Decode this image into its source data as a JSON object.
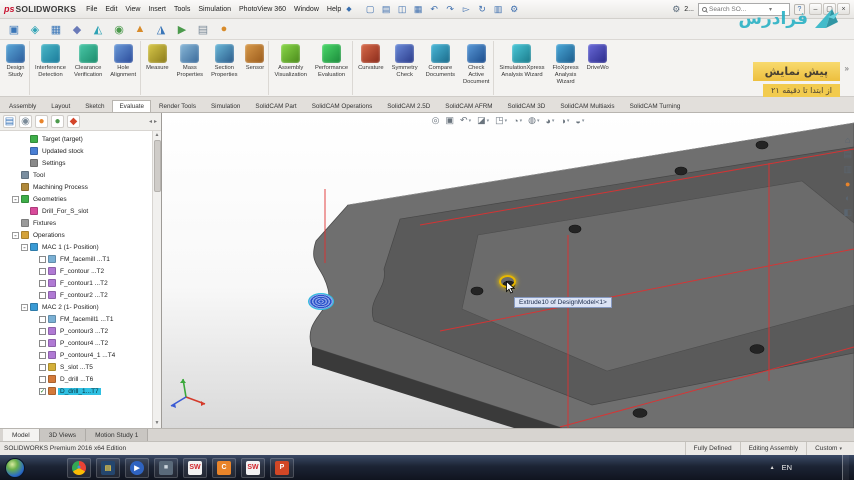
{
  "titlebar": {
    "logo_prefix": "ps",
    "logo_text": "SOLIDWORKS",
    "menus": [
      "File",
      "Edit",
      "View",
      "Insert",
      "Tools",
      "Simulation",
      "PhotoView 360",
      "Window",
      "Help"
    ],
    "pin_glyph": "◆",
    "tools": [
      {
        "name": "new-document-icon",
        "glyph": "▢"
      },
      {
        "name": "open-document-icon",
        "glyph": "▤"
      },
      {
        "name": "save-icon",
        "glyph": "◫"
      },
      {
        "name": "print-icon",
        "glyph": "▦"
      },
      {
        "name": "undo-icon",
        "glyph": "↶"
      },
      {
        "name": "redo-icon",
        "glyph": "↷"
      },
      {
        "name": "select-icon",
        "glyph": "▻"
      },
      {
        "name": "rebuild-icon",
        "glyph": "↻"
      },
      {
        "name": "file-properties-icon",
        "glyph": "▥"
      },
      {
        "name": "options-icon",
        "glyph": "⚙"
      }
    ],
    "right_text": "2...",
    "search": {
      "placeholder": "Search SO...",
      "chevron": "▾",
      "help": "?"
    },
    "window_controls": [
      {
        "name": "minimize-button",
        "glyph": "–"
      },
      {
        "name": "restore-button",
        "glyph": "▢"
      },
      {
        "name": "close-button",
        "glyph": "×"
      }
    ]
  },
  "toolbar2": {
    "icons": [
      {
        "name": "insert-components-icon",
        "glyph": "▣",
        "color": "#3a76b8"
      },
      {
        "name": "mate-icon",
        "glyph": "◈",
        "color": "#2fa3b5"
      },
      {
        "name": "linear-component-pattern-icon",
        "glyph": "▦",
        "color": "#3a76b8"
      },
      {
        "name": "smart-fasteners-icon",
        "glyph": "◆",
        "color": "#6a7ab8"
      },
      {
        "name": "move-component-icon",
        "glyph": "◭",
        "color": "#2fa3b5"
      },
      {
        "name": "show-hidden-components-icon",
        "glyph": "◉",
        "color": "#4c9a4c"
      },
      {
        "name": "assembly-features-icon",
        "glyph": "▲",
        "color": "#d88b2a"
      },
      {
        "name": "reference-geometry-icon",
        "glyph": "◮",
        "color": "#3a76b8"
      },
      {
        "name": "new-motion-study-icon",
        "glyph": "▶",
        "color": "#4c9a4c"
      },
      {
        "name": "bill-of-materials-icon",
        "glyph": "▤",
        "color": "#7a8a98"
      },
      {
        "name": "exploded-view-icon",
        "glyph": "●",
        "color": "#d88b2a"
      }
    ]
  },
  "ribbon": {
    "overflow_chevron": "»",
    "buttons": [
      {
        "name": "design-study-button",
        "lines": [
          "Design",
          "Study",
          ""
        ],
        "icon_bg": "linear-gradient(135deg,#5aa8d8,#2a5a9a)",
        "sep": "with-sep"
      },
      {
        "name": "interference-detection-button",
        "lines": [
          "Interference",
          "Detection",
          ""
        ],
        "icon_bg": "linear-gradient(135deg,#4ab8c8,#1a7a9a)",
        "sep": ""
      },
      {
        "name": "clearance-verification-button",
        "lines": [
          "Clearance",
          "Verification",
          ""
        ],
        "icon_bg": "linear-gradient(135deg,#4ac8a8,#1a8a6a)",
        "sep": ""
      },
      {
        "name": "hole-alignment-button",
        "lines": [
          "Hole",
          "Alignment",
          ""
        ],
        "icon_bg": "linear-gradient(135deg,#6a9ad8,#2a4a9a)",
        "sep": "with-sep"
      },
      {
        "name": "measure-button",
        "lines": [
          "Measure",
          "",
          ""
        ],
        "icon_bg": "linear-gradient(135deg,#d8c84a,#8a7a1a)",
        "sep": ""
      },
      {
        "name": "mass-properties-button",
        "lines": [
          "Mass",
          "Properties",
          ""
        ],
        "icon_bg": "linear-gradient(135deg,#8ab8d8,#3a6a9a)",
        "sep": ""
      },
      {
        "name": "section-properties-button",
        "lines": [
          "Section",
          "Properties",
          ""
        ],
        "icon_bg": "linear-gradient(135deg,#6ab8d8,#2a5a8a)",
        "sep": ""
      },
      {
        "name": "sensor-button",
        "lines": [
          "Sensor",
          "",
          ""
        ],
        "icon_bg": "linear-gradient(135deg,#d89a4a,#9a5a1a)",
        "sep": "with-sep"
      },
      {
        "name": "assembly-visualization-button",
        "lines": [
          "Assembly",
          "Visualization",
          ""
        ],
        "icon_bg": "linear-gradient(135deg,#8ad84a,#4a8a1a)",
        "sep": ""
      },
      {
        "name": "performance-evaluation-button",
        "lines": [
          "Performance",
          "Evaluation",
          ""
        ],
        "icon_bg": "linear-gradient(135deg,#4ad86a,#1a8a3a)",
        "sep": "with-sep"
      },
      {
        "name": "curvature-button",
        "lines": [
          "Curvature",
          "",
          ""
        ],
        "icon_bg": "linear-gradient(135deg,#d86a4a,#8a2a1a)",
        "sep": ""
      },
      {
        "name": "symmetry-check-button",
        "lines": [
          "Symmetry",
          "Check",
          ""
        ],
        "icon_bg": "linear-gradient(135deg,#6a8ad8,#2a3a8a)",
        "sep": ""
      },
      {
        "name": "compare-documents-button",
        "lines": [
          "Compare",
          "Documents",
          ""
        ],
        "icon_bg": "linear-gradient(135deg,#4ab8d8,#1a6a8a)",
        "sep": ""
      },
      {
        "name": "check-active-document-button",
        "lines": [
          "Check",
          "Active",
          "Document"
        ],
        "icon_bg": "linear-gradient(135deg,#5a9ad8,#1a4a8a)",
        "sep": "with-sep"
      },
      {
        "name": "simulationxpress-analysis-wizard-button",
        "lines": [
          "SimulationXpress",
          "Analysis Wizard",
          ""
        ],
        "icon_bg": "linear-gradient(135deg,#4ac8d8,#1a7a8a)",
        "sep": ""
      },
      {
        "name": "floxpress-analysis-wizard-button",
        "lines": [
          "FloXpress",
          "Analysis",
          "Wizard"
        ],
        "icon_bg": "linear-gradient(135deg,#4aa8d8,#1a5a8a)",
        "sep": ""
      },
      {
        "name": "driveworksxpress-wizard-button",
        "lines": [
          "DriveWo",
          "",
          ""
        ],
        "icon_bg": "linear-gradient(135deg,#6a6ad8,#2a2a8a)",
        "sep": ""
      }
    ]
  },
  "tabs": {
    "items": [
      {
        "label": "Assembly",
        "cls": ""
      },
      {
        "label": "Layout",
        "cls": ""
      },
      {
        "label": "Sketch",
        "cls": ""
      },
      {
        "label": "Evaluate",
        "cls": "active"
      },
      {
        "label": "Render Tools",
        "cls": ""
      },
      {
        "label": "Simulation",
        "cls": ""
      },
      {
        "label": "SolidCAM Part",
        "cls": ""
      },
      {
        "label": "SolidCAM Operations",
        "cls": ""
      },
      {
        "label": "SolidCAM 2.5D",
        "cls": ""
      },
      {
        "label": "SolidCAM AFRM",
        "cls": ""
      },
      {
        "label": "SolidCAM 3D",
        "cls": ""
      },
      {
        "label": "SolidCAM Multiaxis",
        "cls": ""
      },
      {
        "label": "SolidCAM Turning",
        "cls": ""
      }
    ]
  },
  "panel": {
    "nav_left": "◂",
    "nav_right": "▸",
    "tools": [
      {
        "name": "solidcam-manager-icon",
        "glyph": "▤",
        "color": "#3a76b8"
      },
      {
        "name": "feature-tree-icon",
        "glyph": "◉",
        "color": "#7a8a98"
      },
      {
        "name": "solidcam-icon",
        "glyph": "●",
        "color": "#e8842a"
      },
      {
        "name": "configurations-icon",
        "glyph": "●",
        "color": "#4c9a4c"
      },
      {
        "name": "display-manager-icon",
        "glyph": "◆",
        "color": "#d4452a"
      }
    ]
  },
  "tree": {
    "items": [
      {
        "label": "Target (target)",
        "depth": 2,
        "exp": "",
        "cb": "n",
        "icon": "#3fae49",
        "sel": ""
      },
      {
        "label": "Updated stock",
        "depth": 2,
        "exp": "",
        "cb": "n",
        "icon": "#4a7fd4",
        "sel": ""
      },
      {
        "label": "Settings",
        "depth": 2,
        "exp": "",
        "cb": "n",
        "icon": "#8a8a8a",
        "sel": ""
      },
      {
        "label": "Tool",
        "depth": 1,
        "exp": "",
        "cb": "n",
        "icon": "#7a8ea0",
        "sel": ""
      },
      {
        "label": "Machining Process",
        "depth": 1,
        "exp": "",
        "cb": "n",
        "icon": "#b0893a",
        "sel": ""
      },
      {
        "label": "Geometries",
        "depth": 1,
        "exp": "-",
        "cb": "n",
        "icon": "#3fae49",
        "sel": ""
      },
      {
        "label": "Drill_For_S_slot",
        "depth": 2,
        "exp": "",
        "cb": "n",
        "icon": "#d84a9a",
        "sel": ""
      },
      {
        "label": "Fixtures",
        "depth": 1,
        "exp": "",
        "cb": "n",
        "icon": "#9a9a9a",
        "sel": ""
      },
      {
        "label": "Operations",
        "depth": 1,
        "exp": "-",
        "cb": "n",
        "icon": "#d4a23a",
        "sel": ""
      },
      {
        "label": "MAC 1 (1- Position)",
        "depth": 2,
        "exp": "-",
        "cb": "n",
        "icon": "#3a9ad4",
        "sel": ""
      },
      {
        "label": "FM_facemill ...T1",
        "depth": 3,
        "exp": "",
        "cb": "u",
        "icon": "#7ab0d4",
        "sel": ""
      },
      {
        "label": "F_contour ...T2",
        "depth": 3,
        "exp": "",
        "cb": "u",
        "icon": "#b07ad4",
        "sel": ""
      },
      {
        "label": "F_contour1 ...T2",
        "depth": 3,
        "exp": "",
        "cb": "u",
        "icon": "#b07ad4",
        "sel": ""
      },
      {
        "label": "F_contour2 ...T2",
        "depth": 3,
        "exp": "",
        "cb": "u",
        "icon": "#b07ad4",
        "sel": ""
      },
      {
        "label": "MAC 2 (1- Position)",
        "depth": 2,
        "exp": "-",
        "cb": "n",
        "icon": "#3a9ad4",
        "sel": ""
      },
      {
        "label": "FM_facemill1 ...T1",
        "depth": 3,
        "exp": "",
        "cb": "u",
        "icon": "#7ab0d4",
        "sel": ""
      },
      {
        "label": "P_contour3 ...T2",
        "depth": 3,
        "exp": "",
        "cb": "u",
        "icon": "#b07ad4",
        "sel": ""
      },
      {
        "label": "P_contour4 ...T2",
        "depth": 3,
        "exp": "",
        "cb": "u",
        "icon": "#b07ad4",
        "sel": ""
      },
      {
        "label": "P_contour4_1 ...T4",
        "depth": 3,
        "exp": "",
        "cb": "u",
        "icon": "#b07ad4",
        "sel": ""
      },
      {
        "label": "S_slot ...T5",
        "depth": 3,
        "exp": "",
        "cb": "u",
        "icon": "#d4b03a",
        "sel": ""
      },
      {
        "label": "D_drill ...T6",
        "depth": 3,
        "exp": "",
        "cb": "u",
        "icon": "#d47a3a",
        "sel": ""
      },
      {
        "label": "D_drill_1...T7",
        "depth": 3,
        "exp": "",
        "cb": "c",
        "icon": "#d47a3a",
        "sel": "selected"
      }
    ]
  },
  "hud": {
    "items": [
      {
        "name": "zoom-fit-icon",
        "glyph": "◎",
        "arrow": ""
      },
      {
        "name": "zoom-area-icon",
        "glyph": "▣",
        "arrow": ""
      },
      {
        "name": "previous-view-icon",
        "glyph": "↶",
        "arrow": "▾"
      },
      {
        "name": "section-view-icon",
        "glyph": "◪",
        "arrow": "▾"
      },
      {
        "name": "view-orientation-icon",
        "glyph": "◳",
        "arrow": "▾"
      },
      {
        "name": "display-style-icon",
        "glyph": "◔",
        "arrow": "▾"
      },
      {
        "name": "hide-show-items-icon",
        "glyph": "◍",
        "arrow": "▾"
      },
      {
        "name": "edit-appearance-icon",
        "glyph": "◕",
        "arrow": "▾"
      },
      {
        "name": "apply-scene-icon",
        "glyph": "◑",
        "arrow": "▾"
      },
      {
        "name": "view-settings-icon",
        "glyph": "◒",
        "arrow": "▾"
      }
    ]
  },
  "right_tools": {
    "items": [
      {
        "name": "home-icon",
        "glyph": "⌂",
        "color": "#5a6570"
      },
      {
        "name": "design-library-icon",
        "glyph": "▤",
        "color": "#5a6570"
      },
      {
        "name": "file-explorer-icon",
        "glyph": "▥",
        "color": "#5a6570"
      },
      {
        "name": "appearances-icon",
        "glyph": "●",
        "color": "#e8842a"
      },
      {
        "name": "scenes-icon",
        "glyph": "◐",
        "color": "#5a6570"
      },
      {
        "name": "custom-properties-icon",
        "glyph": "◧",
        "color": "#5a6570"
      }
    ]
  },
  "viewport": {
    "tooltip": "Extrude10 of DesignModel<1>"
  },
  "watermark": {
    "brand": "فرادرس",
    "badge": "پیش نمایش",
    "subtitle": "از ابتدا تا دقیقه ۲۱"
  },
  "bottom_tabs": {
    "items": [
      {
        "label": "Model",
        "cls": "active"
      },
      {
        "label": "3D Views",
        "cls": ""
      },
      {
        "label": "Motion Study 1",
        "cls": ""
      }
    ]
  },
  "statusbar": {
    "left": "SOLIDWORKS Premium 2016 x64 Edition",
    "items": [
      {
        "label": "Fully Defined",
        "caret": ""
      },
      {
        "label": "Editing Assembly",
        "caret": ""
      },
      {
        "label": "Custom",
        "caret": "▾"
      }
    ]
  },
  "taskbar": {
    "language": "EN",
    "tray_arrow": "▴",
    "icons": [
      {
        "name": "taskbar-chrome",
        "glyph": "●",
        "bg": "conic-gradient(#ea4335 0deg 120deg,#fbbc05 120deg 240deg,#34a853 240deg 360deg)",
        "fg": "#4a90d9",
        "cls": "round"
      },
      {
        "name": "taskbar-explorer",
        "glyph": "▤",
        "bg": "#24466e",
        "fg": "#e8c84a",
        "cls": ""
      },
      {
        "name": "taskbar-media-player",
        "glyph": "▶",
        "bg": "#2f63c0",
        "fg": "#ffffff",
        "cls": "round"
      },
      {
        "name": "taskbar-app",
        "glyph": "■",
        "bg": "#5a6a7a",
        "fg": "#cdd6de",
        "cls": ""
      },
      {
        "name": "taskbar-solidworks",
        "glyph": "SW",
        "bg": "#f2f2f2",
        "fg": "#d1232a",
        "cls": ""
      },
      {
        "name": "taskbar-camworks",
        "glyph": "C",
        "bg": "#e8842a",
        "fg": "#ffffff",
        "cls": ""
      },
      {
        "name": "taskbar-solidworks-2",
        "glyph": "SW",
        "bg": "#f2f2f2",
        "fg": "#d1232a",
        "cls": ""
      },
      {
        "name": "taskbar-powerpoint",
        "glyph": "P",
        "bg": "#d24726",
        "fg": "#ffffff",
        "cls": ""
      }
    ]
  }
}
